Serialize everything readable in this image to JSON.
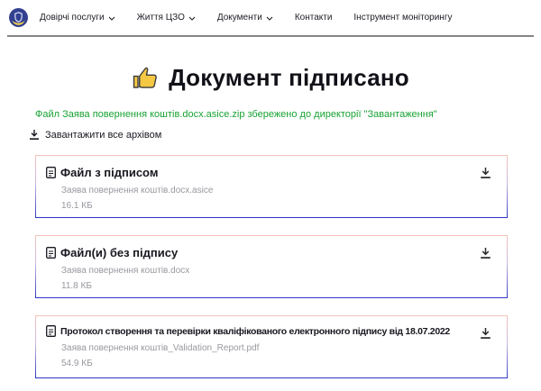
{
  "nav": {
    "logo": "czo-logo",
    "items": [
      {
        "label": "Довірчі послуги",
        "dropdown": true
      },
      {
        "label": "Життя ЦЗО",
        "dropdown": true
      },
      {
        "label": "Документи",
        "dropdown": true
      },
      {
        "label": "Контакти",
        "dropdown": false
      },
      {
        "label": "Інструмент моніторингу",
        "dropdown": false
      }
    ]
  },
  "main": {
    "heading": "Документ підписано",
    "heading_icon": "thumbs-up-icon",
    "status_message": "Файл Заява повернення коштів.docx.asice.zip збережено до директорії \"Завантаження\"",
    "download_all_label": "Завантажити все архівом",
    "cards": [
      {
        "title": "Файл з підписом",
        "filename": "Заява повернення коштів.docx.asice",
        "size": "16.1 КБ"
      },
      {
        "title": "Файл(и) без підпису",
        "filename": "Заява повернення коштів.docx",
        "size": "11.8 КБ"
      },
      {
        "title": "Протокол створення та перевірки кваліфікованого електронного підпису від 18.07.2022",
        "filename": "Заява повернення коштів_Validation_Report.pdf",
        "size": "54.9 КБ"
      }
    ]
  },
  "icons": {
    "logo": "czo-shield-logo",
    "chevron": "chevron-down-icon",
    "heading": "thumbs-up-icon",
    "download": "download-icon",
    "document": "document-icon"
  },
  "colors": {
    "success_green": "#18a233",
    "card_border_top": "#f3c4b9",
    "card_border_bottom": "#2c36c3",
    "text_dark": "#17171f",
    "text_gray": "#98989f",
    "divider_gray": "#858585",
    "logo_blue": "#33418f",
    "logo_yellow": "#ffd94a",
    "thumb_yellow": "#f5c844"
  }
}
